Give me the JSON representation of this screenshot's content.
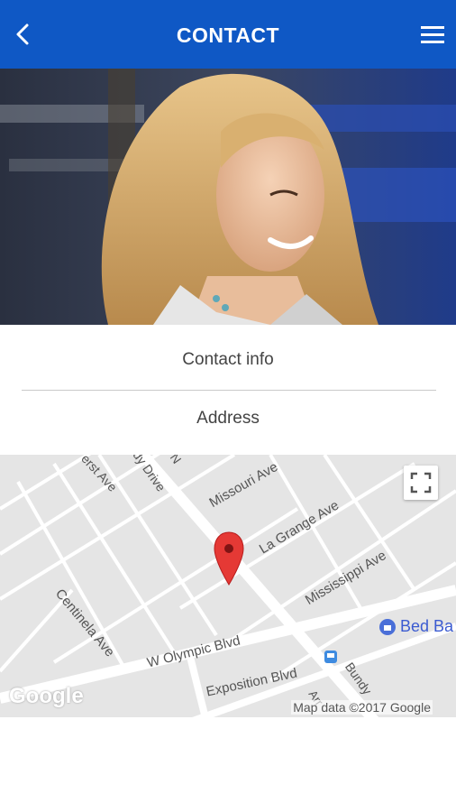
{
  "header": {
    "title": "CONTACT"
  },
  "sections": {
    "contact_info": "Contact info",
    "address": "Address"
  },
  "map": {
    "streets": {
      "missouri": "Missouri Ave",
      "la_grange": "La Grange Ave",
      "mississippi": "Mississippi Ave",
      "centinela": "Centinela Ave",
      "olympic": "W Olympic Blvd",
      "exposition": "Exposition Blvd",
      "bundy": "Bundy",
      "drive": "dy Drive",
      "ave_top": "erst Ave",
      "ave_n": "N",
      "ave_small": "Arr"
    },
    "poi": "Bed Ba",
    "logo": "Google",
    "attribution": "Map data ©2017 Google"
  }
}
